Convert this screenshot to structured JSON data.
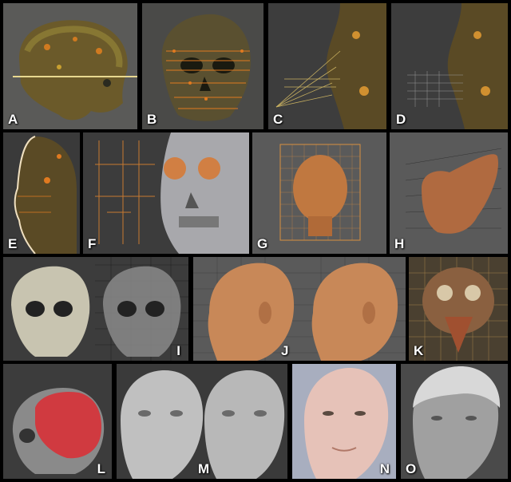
{
  "panels": [
    {
      "label": "A"
    },
    {
      "label": "B"
    },
    {
      "label": "C"
    },
    {
      "label": "D"
    },
    {
      "label": "E"
    },
    {
      "label": "F"
    },
    {
      "label": "G"
    },
    {
      "label": "H"
    },
    {
      "label": "I"
    },
    {
      "label": "J"
    },
    {
      "label": "K"
    },
    {
      "label": "L"
    },
    {
      "label": "M"
    },
    {
      "label": "N"
    },
    {
      "label": "O"
    }
  ]
}
